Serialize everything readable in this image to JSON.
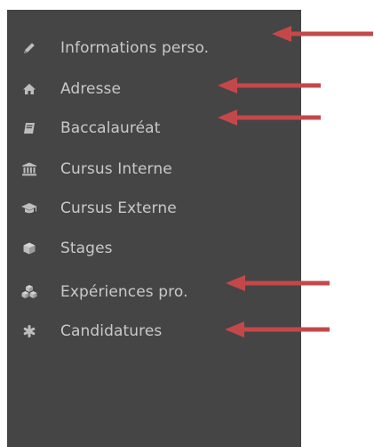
{
  "sidebar": {
    "items": [
      {
        "label": "Informations perso.",
        "icon": "pencil-icon"
      },
      {
        "label": "Adresse",
        "icon": "home-icon"
      },
      {
        "label": "Baccalauréat",
        "icon": "book-icon"
      },
      {
        "label": "Cursus Interne",
        "icon": "institution-icon"
      },
      {
        "label": "Cursus Externe",
        "icon": "graduation-cap-icon"
      },
      {
        "label": "Stages",
        "icon": "cube-icon"
      },
      {
        "label": "Expériences pro.",
        "icon": "cubes-icon"
      },
      {
        "label": "Candidatures",
        "icon": "asterisk-icon"
      }
    ]
  },
  "colors": {
    "sidebar_bg": "#454545",
    "text": "#c9c9c9",
    "icon": "#bdbdbd",
    "arrow": "#c4484a",
    "page_bg": "#ffffff"
  },
  "annotations": {
    "arrows_point_to": [
      "Informations perso.",
      "Adresse",
      "Baccalauréat",
      "Expériences pro.",
      "Candidatures"
    ]
  }
}
